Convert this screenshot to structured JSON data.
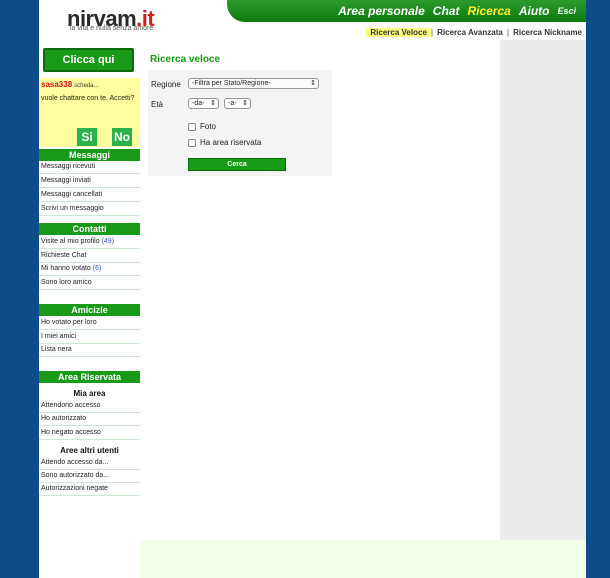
{
  "header": {
    "logo_main": "nirvam",
    "logo_dot": ".it",
    "tagline": "la vita e nulla senza amore"
  },
  "topnav": {
    "items": [
      {
        "label": "Area personale"
      },
      {
        "label": "Chat"
      },
      {
        "label": "Ricerca"
      },
      {
        "label": "Aiuto"
      },
      {
        "label": "Esci"
      }
    ],
    "active": "Ricerca"
  },
  "subnav": {
    "items": [
      {
        "label": "Ricerca Veloce"
      },
      {
        "label": "Ricerca Avanzata"
      },
      {
        "label": "Ricerca Nickname"
      }
    ],
    "separator": "|"
  },
  "sidebar": {
    "clicca": "Clicca qui",
    "chat_request": {
      "user": "sasa338",
      "scheda": "scheda...",
      "message": "vuole chattare con te. Accetti?",
      "yes": "Si",
      "no": "No"
    },
    "messaggi": {
      "title": "Messaggi",
      "items": [
        "Messaggi ricevuti",
        "Messaggi inviati",
        "Messaggi cancellati",
        "Scrivi un messaggio"
      ]
    },
    "contatti": {
      "title": "Contatti",
      "items": [
        {
          "label": "Visite al mio profilo",
          "count": "(49)"
        },
        {
          "label": "Richieste Chat",
          "count": ""
        },
        {
          "label": "Mi hanno votato",
          "count": "(6)"
        },
        {
          "label": "Sono loro amico",
          "count": ""
        }
      ]
    },
    "amicizie": {
      "title": "Amicizie",
      "items": [
        "Ho votato per loro",
        "I miei amici",
        "Lista nera"
      ]
    },
    "area_riservata": {
      "title": "Area Riservata",
      "mia_area": {
        "title": "Mia area",
        "items": [
          "Attendono accesso",
          "Ho autorizzato",
          "Ho negato accesso"
        ]
      },
      "altri_utenti": {
        "title": "Aree altri utenti",
        "items": [
          "Attendo accesso da...",
          "Sono autorizzato da...",
          "Autorizzazioni negate"
        ]
      }
    }
  },
  "main": {
    "title": "Ricerca veloce",
    "form": {
      "region_label": "Regione",
      "region_value": "-Filtra per Stato/Regione-",
      "age_label": "Età",
      "age_from": "-da-",
      "age_to": "-a-",
      "foto_label": "Foto",
      "riservata_label": "Ha area riservata",
      "submit": "Cerca"
    }
  },
  "colors": {
    "brand_green": "#189a18",
    "background_blue": "#0d4d8a",
    "active_yellow": "#ffee33",
    "chat_yellow": "#ffffa0"
  }
}
